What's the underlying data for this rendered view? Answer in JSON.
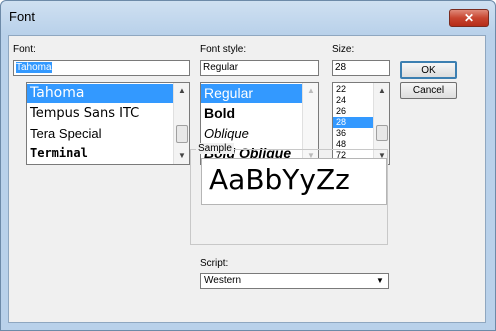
{
  "window": {
    "title": "Font",
    "close_glyph": "✕"
  },
  "font": {
    "label": "Font:",
    "value": "Tahoma",
    "items": [
      "Tahoma",
      "Tempus Sans ITC",
      "Tera Special",
      "Terminal"
    ],
    "selected_index": 0
  },
  "style": {
    "label": "Font style:",
    "value": "Regular",
    "items": [
      "Regular",
      "Bold",
      "Oblique",
      "Bold Oblique"
    ],
    "selected_index": 0
  },
  "size": {
    "label": "Size:",
    "value": "28",
    "items": [
      "22",
      "24",
      "26",
      "28",
      "36",
      "48",
      "72"
    ],
    "selected_index": 3
  },
  "buttons": {
    "ok": "OK",
    "cancel": "Cancel"
  },
  "sample": {
    "label": "Sample",
    "text": "AaBbYyZz"
  },
  "script": {
    "label": "Script:",
    "value": "Western"
  },
  "icons": {
    "scroll_up": "up-arrow",
    "scroll_down": "down-arrow",
    "dropdown": "chevron-down"
  },
  "colors": {
    "selection": "#3399ff",
    "title_bar": "#b9d1ea",
    "close_button": "#c7452f"
  }
}
